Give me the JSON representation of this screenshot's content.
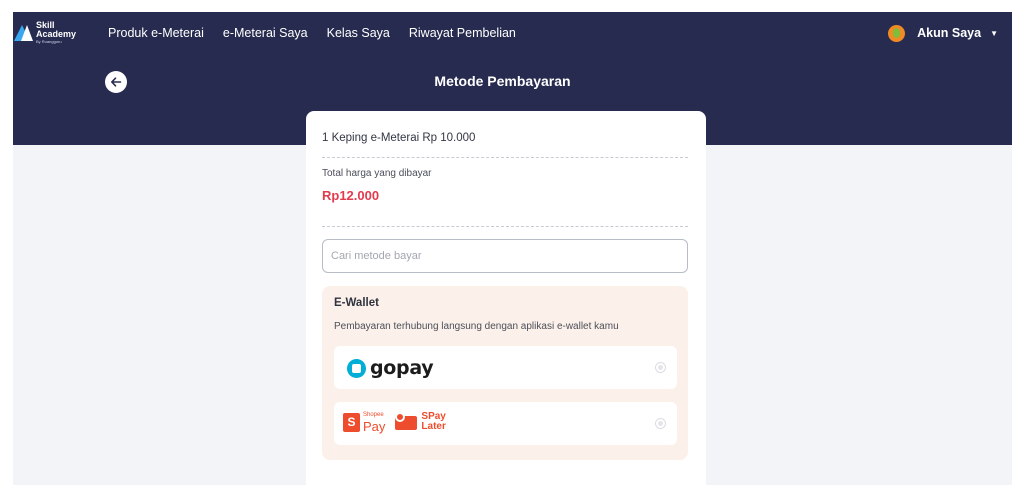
{
  "brand": {
    "line1": "Skill",
    "line2": "Academy",
    "line3": "By Ruangguru"
  },
  "nav": {
    "links": [
      "Produk e-Meterai",
      "e-Meterai Saya",
      "Kelas Saya",
      "Riwayat Pembelian"
    ],
    "account_label": "Akun Saya",
    "caret": "▼"
  },
  "header": {
    "title": "Metode Pembayaran"
  },
  "order": {
    "product_line": "1 Keping e-Meterai Rp 10.000",
    "total_label": "Total harga yang dibayar",
    "total_value": "Rp12.000"
  },
  "search": {
    "placeholder": "Cari metode bayar",
    "value": ""
  },
  "ewallet": {
    "title": "E-Wallet",
    "description": "Pembayaran terhubung langsung dengan aplikasi e-wallet kamu",
    "options": [
      {
        "name": "gopay",
        "selected": false
      },
      {
        "shopeepay_small": "Shopee",
        "shopeepay_big": "Pay",
        "shopeepay_badge": "S",
        "spaylater_top": "SPay",
        "spaylater_bottom": "Later",
        "selected": false
      }
    ]
  },
  "colors": {
    "navy": "#272b4f",
    "accent_red": "#e33a4e",
    "gopay_blue": "#00aed6",
    "shopee_orange": "#ee4d2d",
    "ewallet_bg": "#fcf1ea"
  },
  "icons": {
    "back": "arrow-left-icon",
    "caret": "chevron-down-icon"
  }
}
